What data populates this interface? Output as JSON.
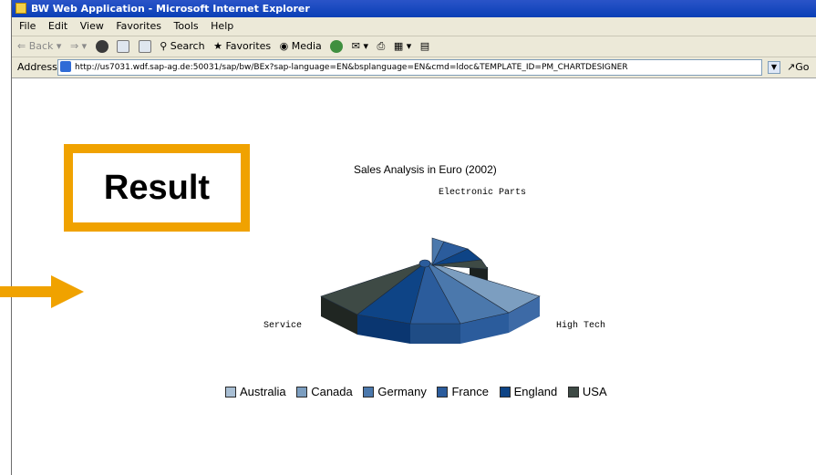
{
  "window": {
    "title": "BW Web Application - Microsoft Internet Explorer"
  },
  "menu": [
    "File",
    "Edit",
    "View",
    "Favorites",
    "Tools",
    "Help"
  ],
  "toolbar": {
    "back": "Back",
    "search": "Search",
    "favorites": "Favorites",
    "media": "Media"
  },
  "address": {
    "label": "Address",
    "url": "http://us7031.wdf.sap-ag.de:50031/sap/bw/BEx?sap-language=EN&bsplanguage=EN&cmd=ldoc&TEMPLATE_ID=PM_CHARTDESIGNER",
    "go": "Go"
  },
  "callout": {
    "label": "Result",
    "color": "#f0a200"
  },
  "chart_data": {
    "type": "pie",
    "title": "Sales Analysis in Euro (2002)",
    "categories": [
      "Electronic Parts",
      "High Tech",
      "Service"
    ],
    "series": [
      {
        "name": "Australia",
        "color": "#a9bfd4"
      },
      {
        "name": "Canada",
        "color": "#7c9ec0"
      },
      {
        "name": "Germany",
        "color": "#4b78ac"
      },
      {
        "name": "France",
        "color": "#2b5c9c"
      },
      {
        "name": "England",
        "color": "#0e4486"
      },
      {
        "name": "USA",
        "color": "#3e4a45"
      }
    ]
  }
}
